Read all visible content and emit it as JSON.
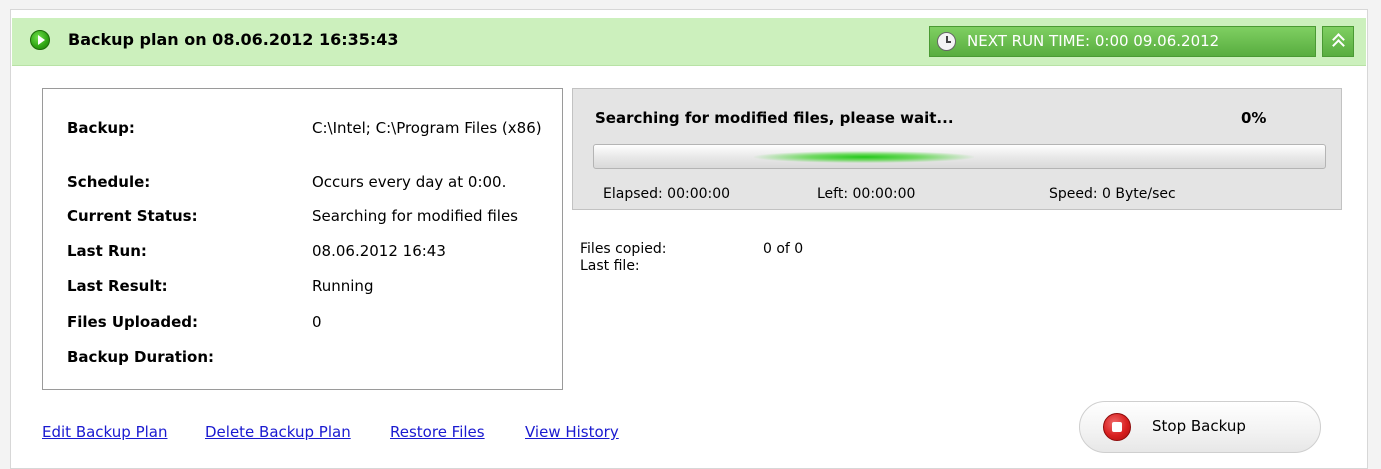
{
  "plan": {
    "title": "Backup plan on 08.06.2012 16:35:43",
    "next_run": "NEXT RUN TIME: 0:00 09.06.2012"
  },
  "info": {
    "rows": [
      {
        "label": "Backup:",
        "value": "C:\\Intel; C:\\Program Files (x86)"
      },
      {
        "label": "Schedule:",
        "value": "Occurs every day at 0:00."
      },
      {
        "label": "Current Status:",
        "value": "Searching for modified files"
      },
      {
        "label": "Last Run:",
        "value": "08.06.2012 16:43"
      },
      {
        "label": "Last Result:",
        "value": "Running"
      },
      {
        "label": "Files Uploaded:",
        "value": "0"
      },
      {
        "label": "Backup Duration:",
        "value": ""
      }
    ]
  },
  "progress": {
    "status": "Searching for modified files, please wait...",
    "percent": "0%",
    "elapsed": "Elapsed: 00:00:00",
    "left": "Left: 00:00:00",
    "speed": "Speed: 0 Byte/sec"
  },
  "files": {
    "copied_label": "Files copied:",
    "copied_value": "0 of 0",
    "last_file_label": "Last file:"
  },
  "links": {
    "edit": "Edit Backup Plan",
    "delete": "Delete Backup Plan",
    "restore": "Restore Files",
    "history": "View History"
  },
  "stop_button": {
    "label": "Stop Backup"
  },
  "colors": {
    "header_bg": "#ccf0bd",
    "next_run_bg": "#6cc04f",
    "link": "#1a1ad0",
    "stop_red": "#d81f1f"
  },
  "icons": {
    "status": "play-icon",
    "next_run": "clock-icon",
    "collapse": "double-chevron-up-icon",
    "stop": "stop-icon"
  }
}
